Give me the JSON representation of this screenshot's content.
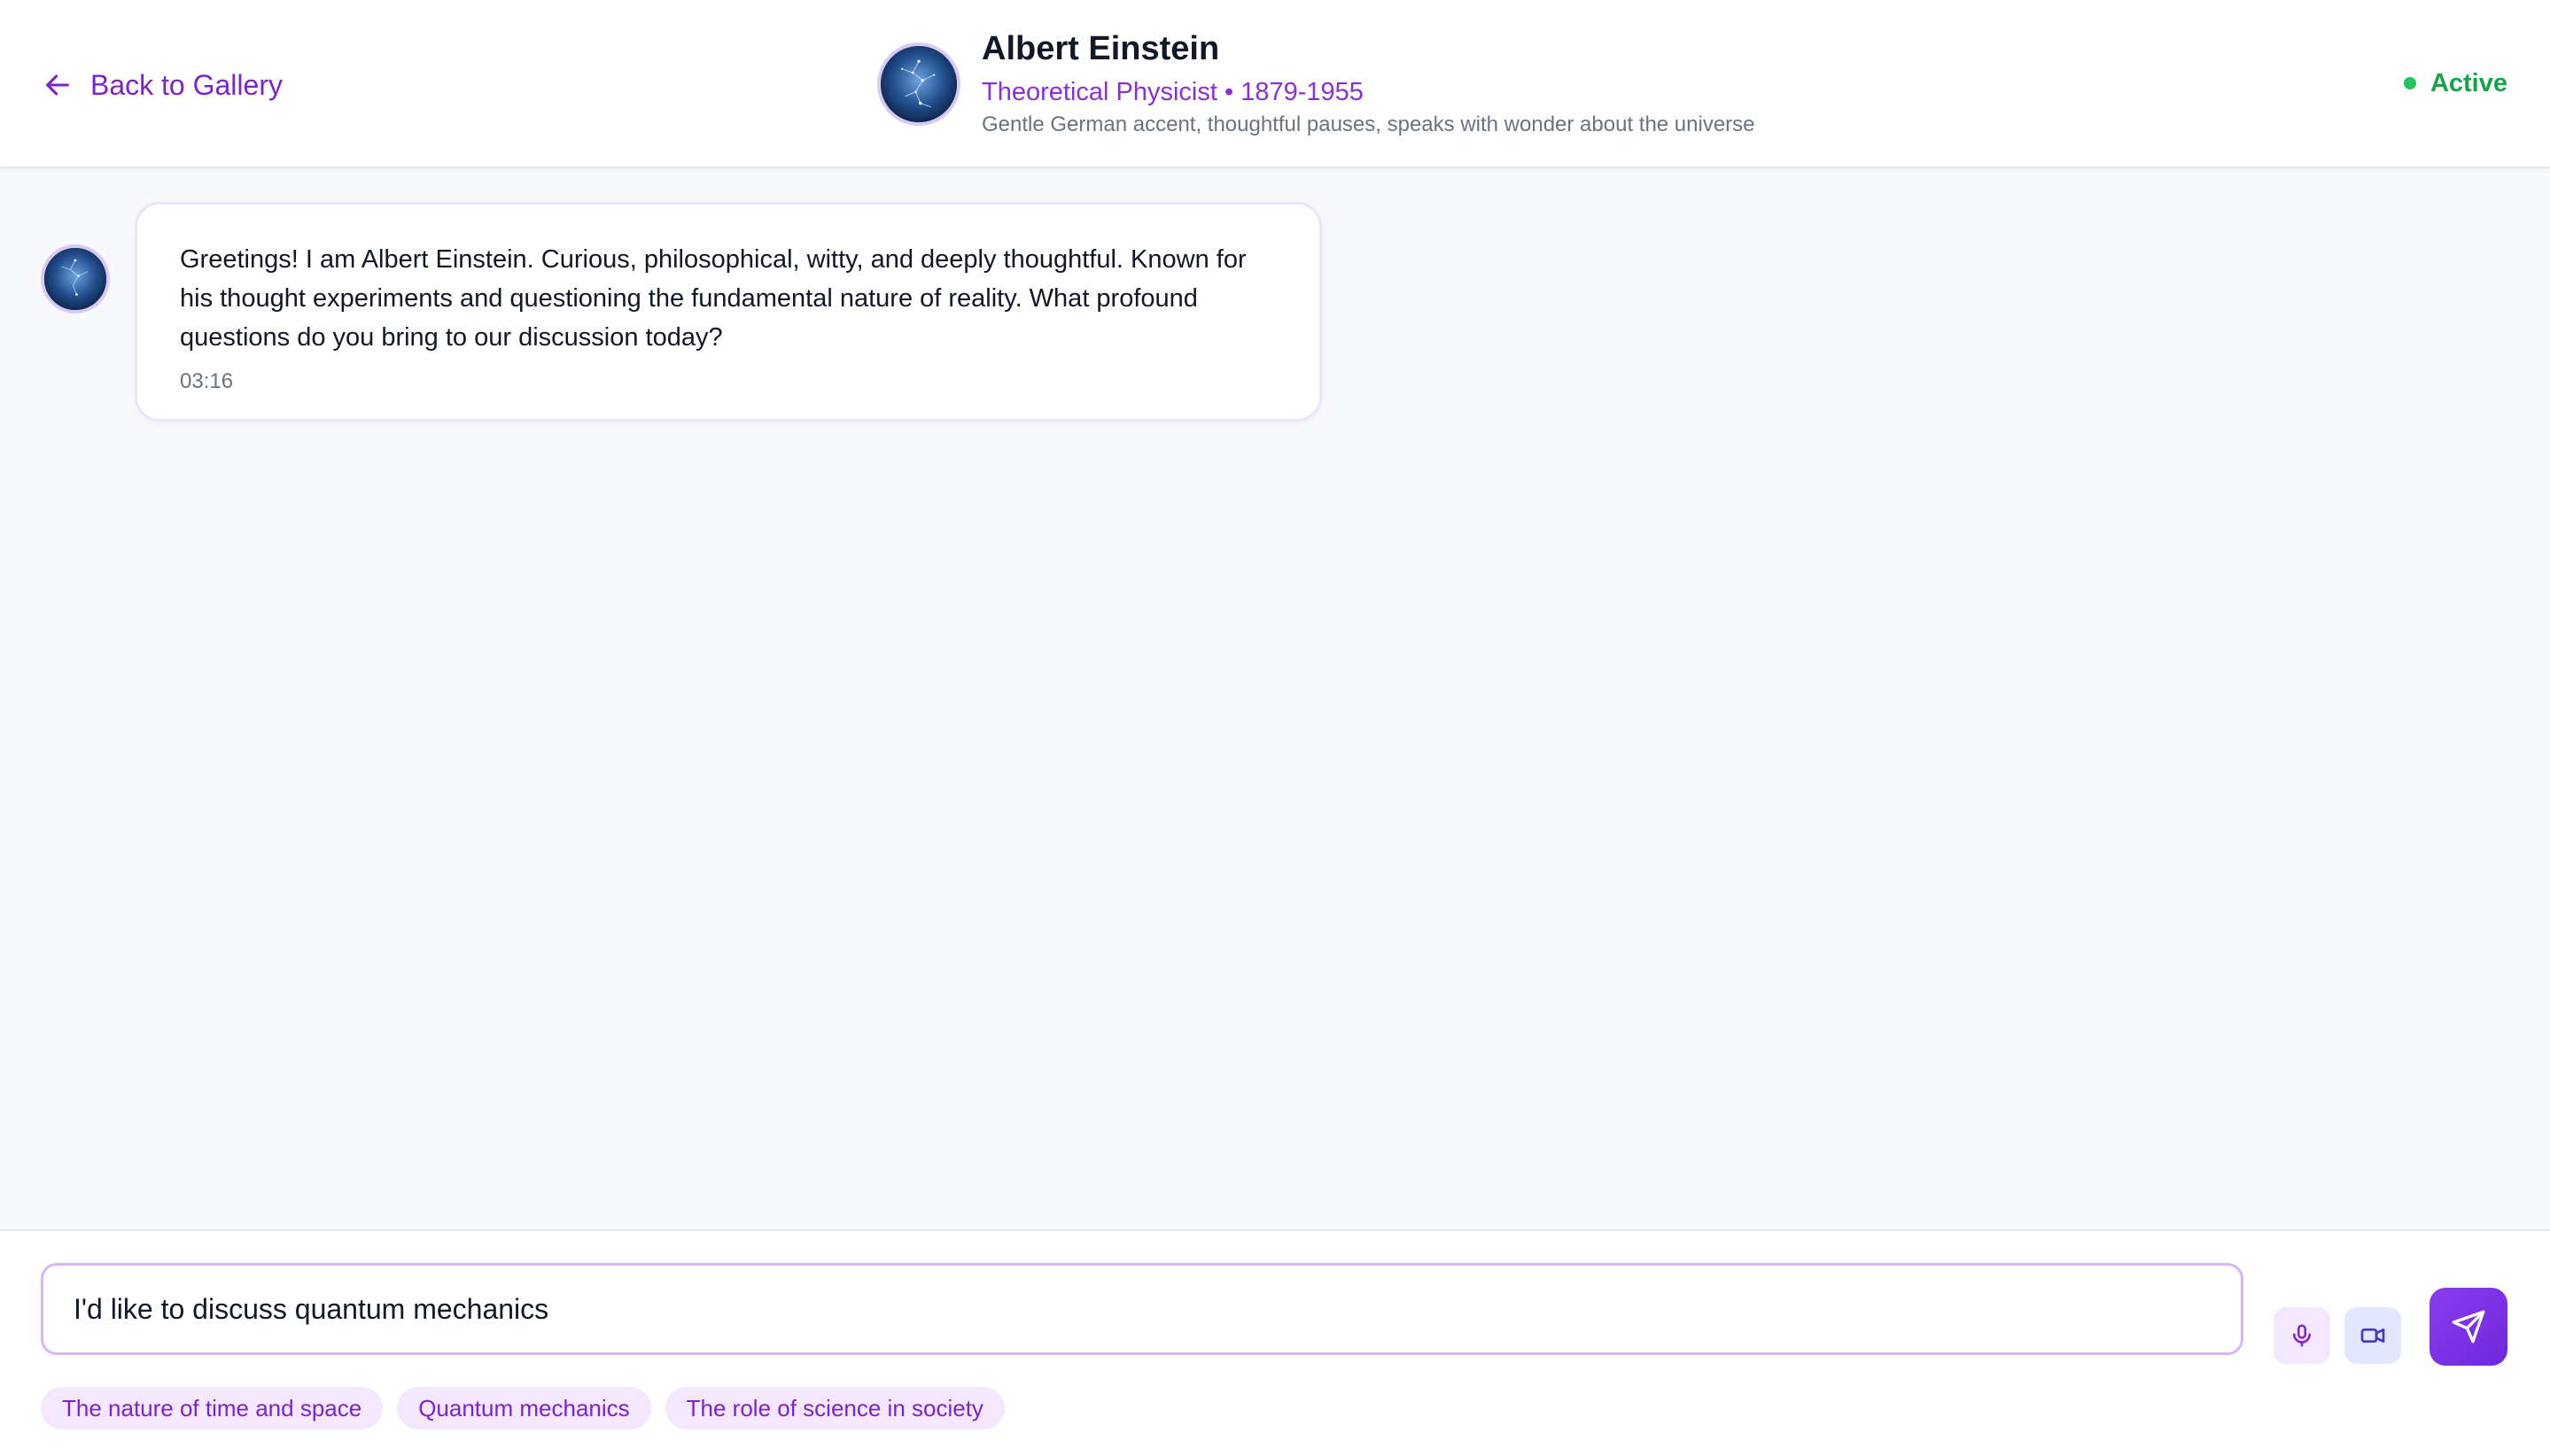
{
  "header": {
    "back_label": "Back to Gallery",
    "name": "Albert Einstein",
    "role": "Theoretical Physicist • 1879-1955",
    "description": "Gentle German accent, thoughtful pauses, speaks with wonder about the universe",
    "status": "Active"
  },
  "messages": [
    {
      "text": "Greetings! I am Albert Einstein. Curious, philosophical, witty, and deeply thoughtful. Known for his thought experiments and questioning the fundamental nature of reality. What profound questions do you bring to our discussion today?",
      "time": "03:16"
    }
  ],
  "composer": {
    "input_value": "I'd like to discuss quantum mechanics",
    "suggestions": [
      "The nature of time and space",
      "Quantum mechanics",
      "The role of science in society"
    ]
  },
  "colors": {
    "accent": "#7e22ce",
    "status_green": "#16a34a",
    "chip_bg": "#f3e8ff"
  },
  "icons": {
    "back": "arrow-left-icon",
    "mic": "microphone-icon",
    "video": "video-camera-icon",
    "send": "send-icon"
  }
}
